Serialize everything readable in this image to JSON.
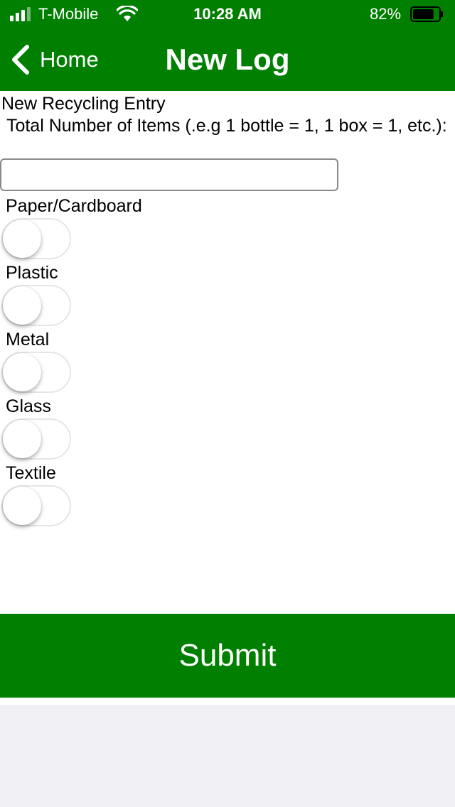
{
  "status_bar": {
    "carrier": "T-Mobile",
    "time": "10:28 AM",
    "battery_percent": "82%",
    "battery_level": 0.82,
    "signal_icon": "signal-bars-icon",
    "wifi_icon": "wifi-icon",
    "battery_icon": "battery-icon"
  },
  "nav": {
    "back_label": "Home",
    "back_icon": "chevron-left-icon",
    "title": "New Log"
  },
  "form": {
    "title": "New Recycling Entry",
    "total_label": " Total Number of Items (.e.g 1 bottle = 1, 1 box = 1, etc.):",
    "total_value": "",
    "categories": [
      {
        "label": "Paper/Cardboard",
        "checked": false
      },
      {
        "label": "Plastic",
        "checked": false
      },
      {
        "label": "Metal",
        "checked": false
      },
      {
        "label": "Glass",
        "checked": false
      },
      {
        "label": "Textile",
        "checked": false
      }
    ],
    "submit_label": "Submit"
  },
  "colors": {
    "brand_green": "#007f00",
    "footer_gray": "#efeff4",
    "white": "#ffffff"
  }
}
